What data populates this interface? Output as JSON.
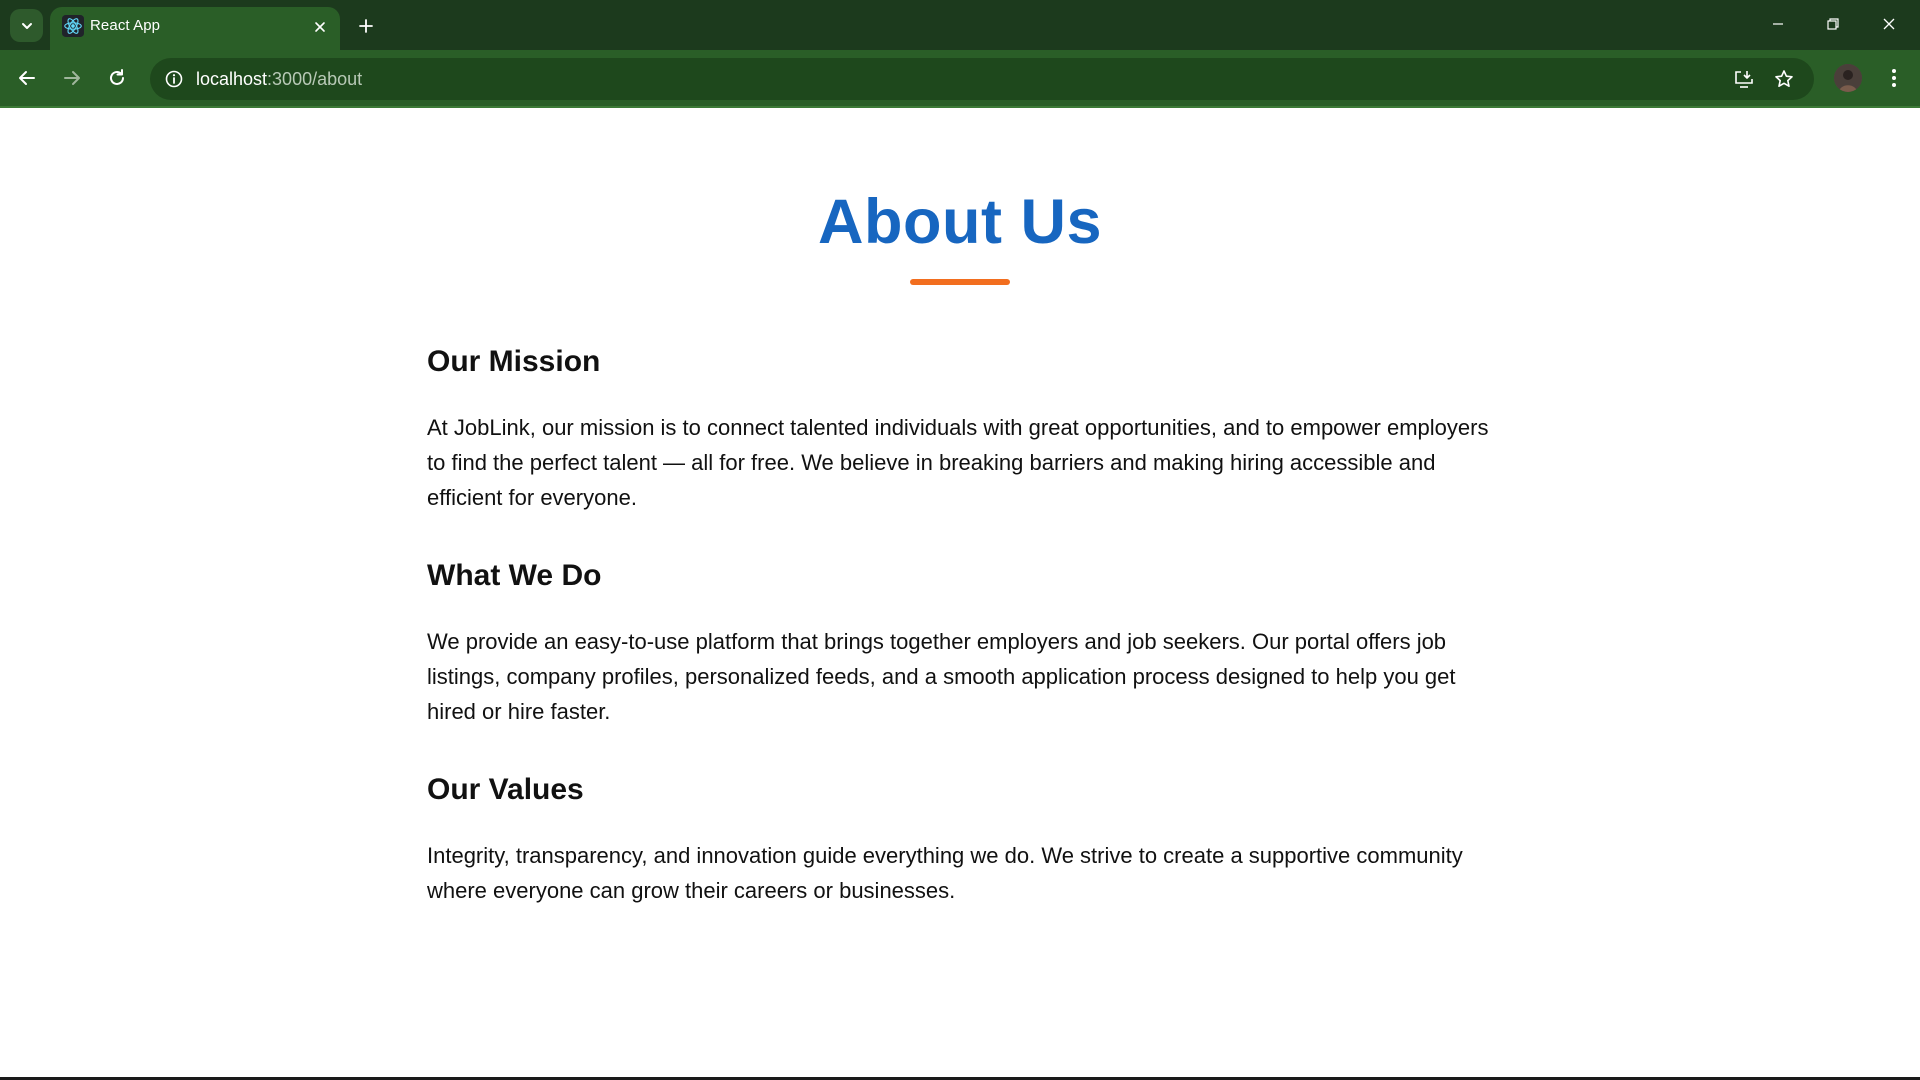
{
  "browser": {
    "tab_title": "React App",
    "url_host": "localhost",
    "url_path": ":3000/about"
  },
  "page": {
    "title": "About Us",
    "sections": [
      {
        "heading": "Our Mission",
        "text": "At JobLink, our mission is to connect talented individuals with great opportunities, and to empower employers to find the perfect talent — all for free. We believe in breaking barriers and making hiring accessible and efficient for everyone."
      },
      {
        "heading": "What We Do",
        "text": "We provide an easy-to-use platform that brings together employers and job seekers. Our portal offers job listings, company profiles, personalized feeds, and a smooth application process designed to help you get hired or hire faster."
      },
      {
        "heading": "Our Values",
        "text": "Integrity, transparency, and innovation guide everything we do. We strive to create a supportive community where everyone can grow their careers or businesses."
      }
    ]
  },
  "colors": {
    "title": "#1766c0",
    "accent": "#f26e1f",
    "chrome": "#2a5e27"
  }
}
